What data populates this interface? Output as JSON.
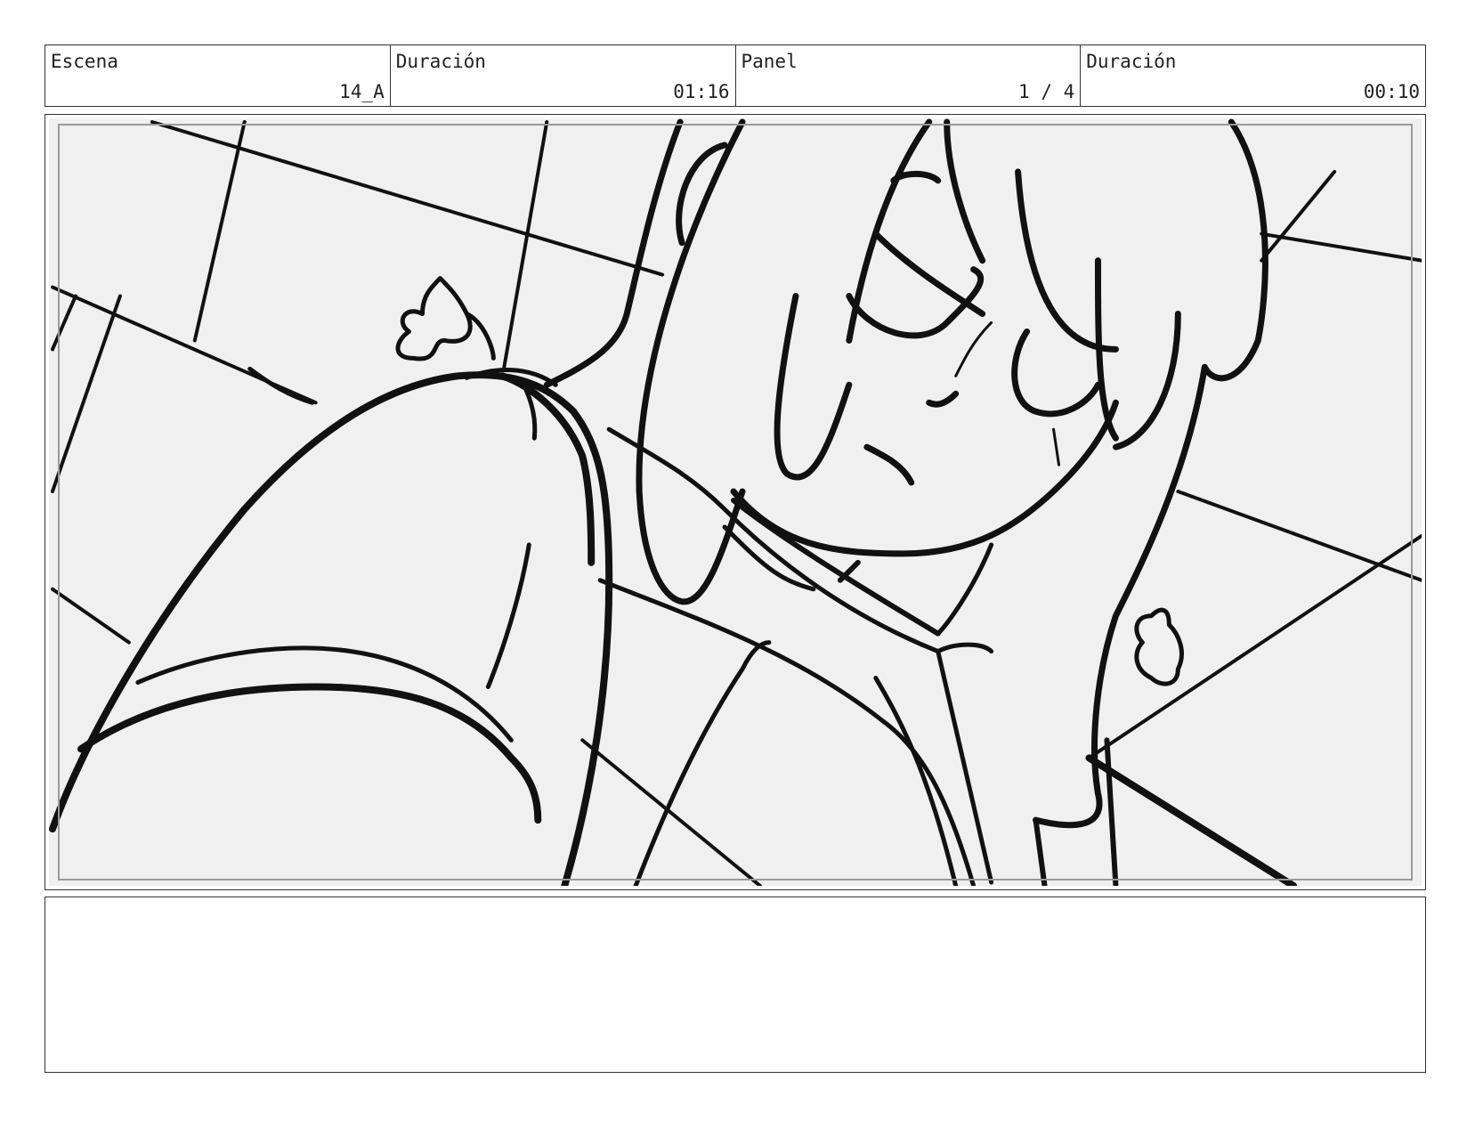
{
  "header": {
    "scene": {
      "label": "Escena",
      "value": "14_A"
    },
    "scene_duration": {
      "label": "Duración",
      "value": "01:16"
    },
    "panel": {
      "label": "Panel",
      "value": "1 / 4"
    },
    "panel_duration": {
      "label": "Duración",
      "value": "00:10"
    }
  },
  "panel_image": {
    "icon": "sketch-drawing",
    "background_color": "#f0f0f0",
    "line_color": "#111111"
  },
  "notes": {
    "text": ""
  }
}
